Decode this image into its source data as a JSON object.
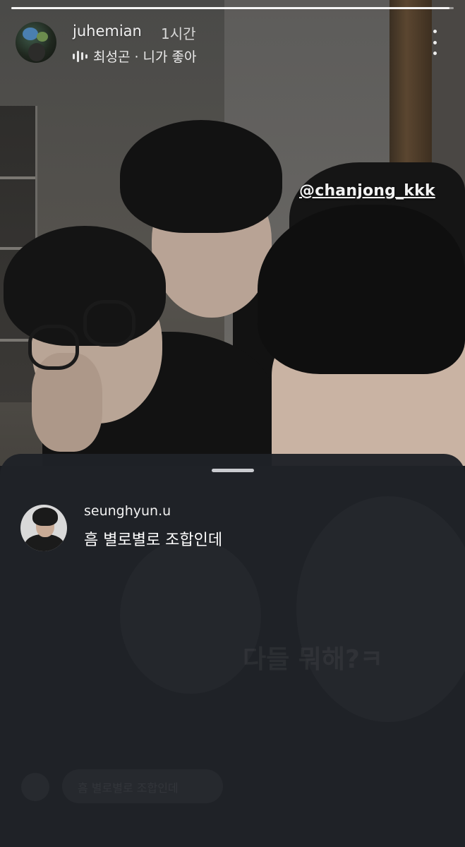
{
  "story": {
    "username": "juhemian",
    "time": "1시간",
    "music": "최성곤 · 니가 좋아",
    "progress": 0.99,
    "mention": "@chanjong_kkk"
  },
  "reply": {
    "username": "seunghyun.u",
    "text": "흠 별로별로 조합인데"
  },
  "background": {
    "faded_sticker": "다들 뭐해?ㅋ",
    "faded_bubble": "흠 별로별로 조합인데"
  },
  "icons": {
    "music": "equalizer-icon",
    "more": "more-vertical-icon"
  }
}
